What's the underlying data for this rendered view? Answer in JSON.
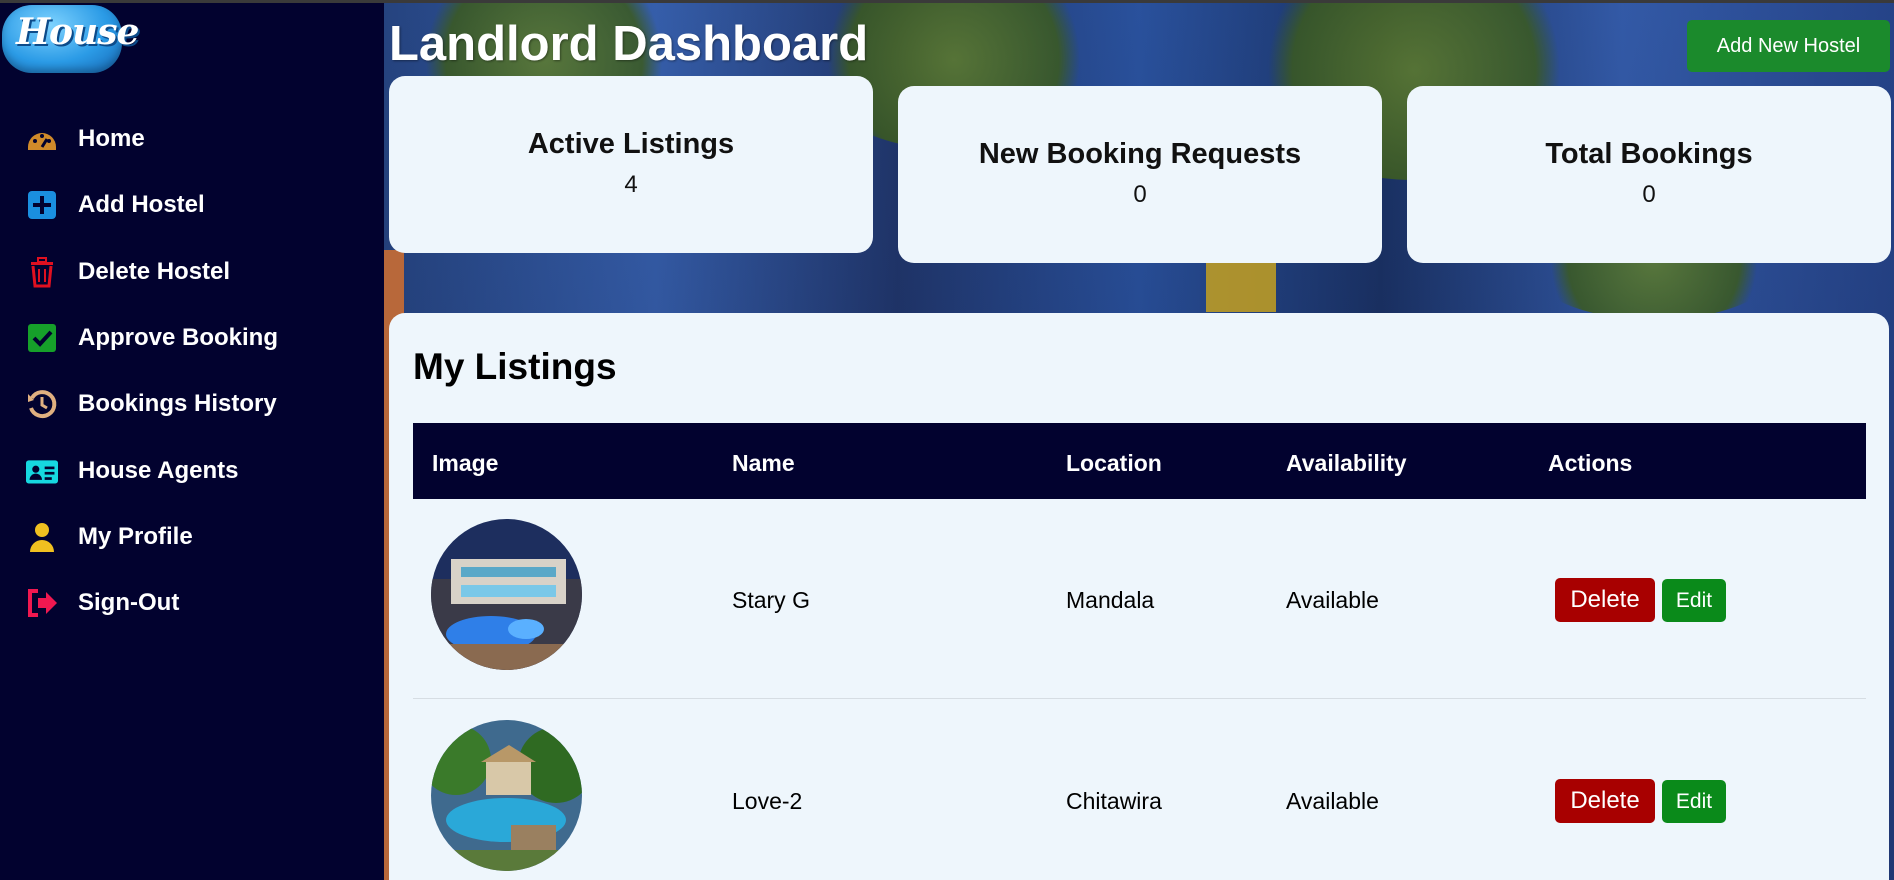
{
  "app": {
    "logo_text": "House"
  },
  "sidebar": {
    "items": [
      {
        "label": "Home",
        "icon": "dashboard-gauge-icon",
        "color": "#d08a2a"
      },
      {
        "label": "Add Hostel",
        "icon": "plus-square-icon",
        "color": "#1a8fe0"
      },
      {
        "label": "Delete Hostel",
        "icon": "trash-icon",
        "color": "#e01020"
      },
      {
        "label": "Approve Booking",
        "icon": "check-square-icon",
        "color": "#16a02a"
      },
      {
        "label": "Bookings History",
        "icon": "history-icon",
        "color": "#e0b080"
      },
      {
        "label": "House Agents",
        "icon": "id-card-icon",
        "color": "#16d8e0"
      },
      {
        "label": "My Profile",
        "icon": "user-icon",
        "color": "#f0c020"
      },
      {
        "label": "Sign-Out",
        "icon": "sign-out-icon",
        "color": "#f01850"
      }
    ]
  },
  "header": {
    "title": "Landlord Dashboard",
    "add_button": "Add New Hostel"
  },
  "stats": [
    {
      "label": "Active Listings",
      "value": "4"
    },
    {
      "label": "New Booking Requests",
      "value": "0"
    },
    {
      "label": "Total Bookings",
      "value": "0"
    }
  ],
  "listings": {
    "title": "My Listings",
    "columns": [
      "Image",
      "Name",
      "Location",
      "Availability",
      "Actions"
    ],
    "rows": [
      {
        "name": "Stary G",
        "location": "Mandala",
        "availability": "Available",
        "delete": "Delete",
        "edit": "Edit"
      },
      {
        "name": "Love-2",
        "location": "Chitawira",
        "availability": "Available",
        "delete": "Delete",
        "edit": "Edit"
      }
    ]
  },
  "colors": {
    "sidebar_bg": "#02022f",
    "card_bg": "#eef6fc",
    "delete": "#a80000",
    "edit": "#0a8a1a",
    "add_new": "#1b8a2c"
  }
}
